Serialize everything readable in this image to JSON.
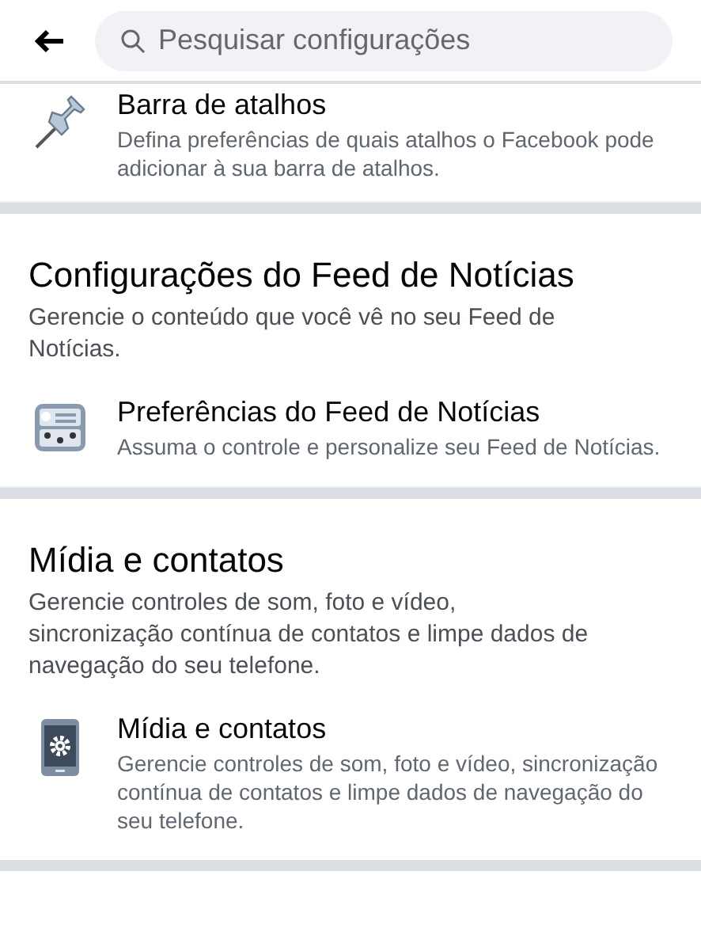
{
  "search": {
    "placeholder": "Pesquisar configurações"
  },
  "sections": [
    {
      "items": [
        {
          "kind": "pin",
          "title": "Barra de atalhos",
          "description": "Defina preferências de quais atalhos o Facebook pode adicionar à sua barra de atalhos."
        }
      ]
    },
    {
      "title": "Configurações do Feed de Notícias",
      "description": "Gerencie o conteúdo que você vê no seu Feed de Notícias.",
      "items": [
        {
          "kind": "feed",
          "title": "Preferências do Feed de Notícias",
          "description": "Assuma o controle e personalize seu Feed de Notícias."
        }
      ]
    },
    {
      "title": "Mídia e contatos",
      "description": "Gerencie controles de som, foto e vídeo, sincronização contínua de contatos e limpe dados de navegação do seu telefone.",
      "items": [
        {
          "kind": "phone",
          "title": "Mídia e contatos",
          "description": "Gerencie controles de som, foto e vídeo, sincronização contínua de contatos e limpe dados de navegação do seu telefone."
        }
      ]
    }
  ]
}
